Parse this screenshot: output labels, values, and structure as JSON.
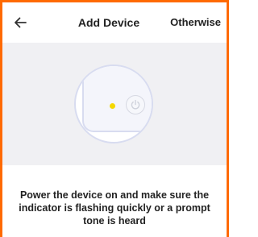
{
  "header": {
    "back_icon": "arrow-left-icon",
    "title": "Add Device",
    "otherwise_label": "Otherwise"
  },
  "illustration": {
    "indicator_color": "#f5d800",
    "power_icon": "power-icon"
  },
  "instruction": {
    "text": "Power the device on and make sure the indicator is flashing quickly or a prompt tone is heard"
  },
  "colors": {
    "frame_border": "#ff6a00",
    "illustration_bg": "#f0f0f3",
    "outline": "#d8dcf0"
  }
}
